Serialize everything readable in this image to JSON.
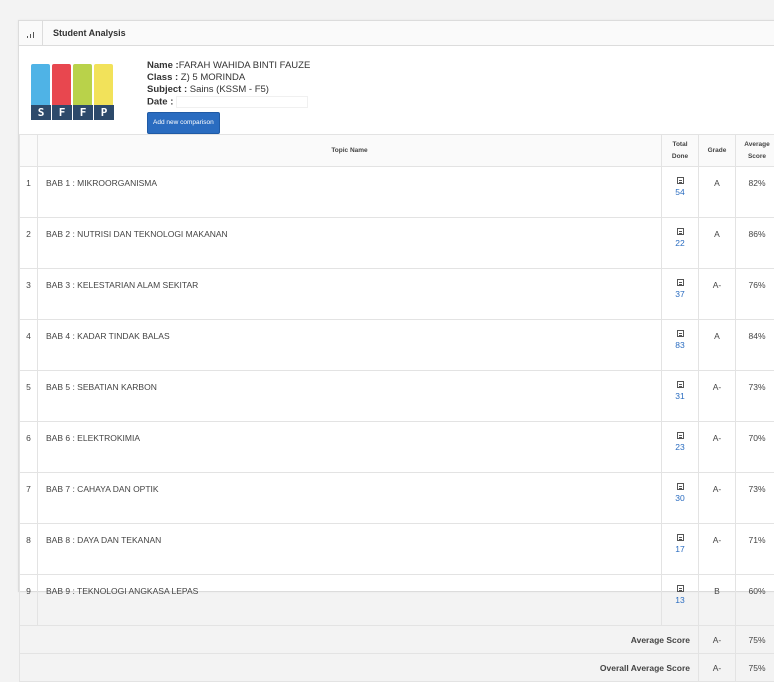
{
  "panel": {
    "title": "Student Analysis"
  },
  "student": {
    "name_label": "Name :",
    "name": "FARAH WAHIDA BINTI FAUZE",
    "class_label": "Class :",
    "class": "Z) 5 MORINDA",
    "subject_label": "Subject :",
    "subject": "Sains (KSSM - F5)",
    "date_label": "Date :",
    "add_button": "Add new comparison"
  },
  "logo": {
    "letters": [
      "S",
      "F",
      "F",
      "P"
    ],
    "colors": [
      "#4fb3e6",
      "#e8474f",
      "#b9d24a",
      "#f2e25a"
    ]
  },
  "table": {
    "headers": {
      "topic": "Topic Name",
      "total_1": "Total",
      "total_2": "Done",
      "grade": "Grade",
      "avg_1": "Average",
      "avg_2": "Score"
    },
    "rows": [
      {
        "no": "1",
        "topic": "BAB 1 : MIKROORGANISMA",
        "total": "54",
        "grade": "A",
        "avg": "82%"
      },
      {
        "no": "2",
        "topic": "BAB 2 : NUTRISI DAN TEKNOLOGI MAKANAN",
        "total": "22",
        "grade": "A",
        "avg": "86%"
      },
      {
        "no": "3",
        "topic": "BAB 3 : KELESTARIAN ALAM SEKITAR",
        "total": "37",
        "grade": "A-",
        "avg": "76%"
      },
      {
        "no": "4",
        "topic": "BAB 4 : KADAR TINDAK BALAS",
        "total": "83",
        "grade": "A",
        "avg": "84%"
      },
      {
        "no": "5",
        "topic": "BAB 5 : SEBATIAN KARBON",
        "total": "31",
        "grade": "A-",
        "avg": "73%"
      },
      {
        "no": "6",
        "topic": "BAB 6 : ELEKTROKIMIA",
        "total": "23",
        "grade": "A-",
        "avg": "70%"
      },
      {
        "no": "7",
        "topic": "BAB 7 : CAHAYA DAN OPTIK",
        "total": "30",
        "grade": "A-",
        "avg": "73%"
      },
      {
        "no": "8",
        "topic": "BAB 8 : DAYA DAN TEKANAN",
        "total": "17",
        "grade": "A-",
        "avg": "71%"
      },
      {
        "no": "9",
        "topic": "BAB 9 : TEKNOLOGI ANGKASA LEPAS",
        "total": "13",
        "grade": "B",
        "avg": "60%"
      }
    ],
    "footer": {
      "avg_label": "Average Score",
      "avg_grade": "A-",
      "avg_score": "75%",
      "overall_label": "Overall Average Score",
      "overall_grade": "A-",
      "overall_score": "75%"
    }
  }
}
